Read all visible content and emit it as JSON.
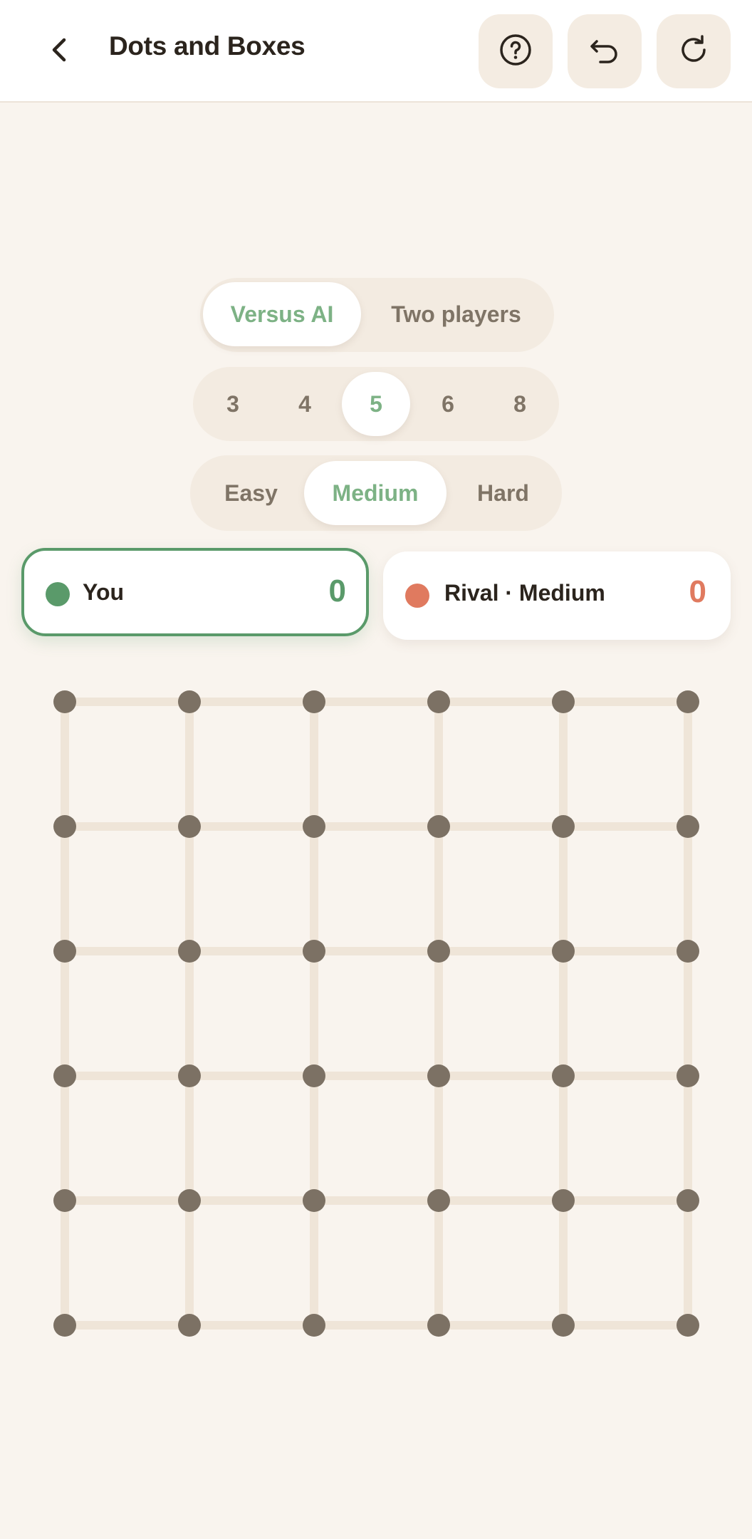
{
  "header": {
    "title": "Dots and Boxes"
  },
  "icons": {
    "back": "chevron-left-icon",
    "help": "help-circle-icon",
    "undo": "undo-icon",
    "restart": "refresh-icon"
  },
  "mode_options": [
    "Versus AI",
    "Two players"
  ],
  "mode_selected": "Versus AI",
  "size_options": [
    "3",
    "4",
    "5",
    "6",
    "8"
  ],
  "size_selected": "5",
  "difficulty_options": [
    "Easy",
    "Medium",
    "Hard"
  ],
  "difficulty_selected": "Medium",
  "players": [
    {
      "name": "You",
      "score": "0",
      "color": "#5a9a6a",
      "active": true
    },
    {
      "name": "Rival · Medium",
      "score": "0",
      "color": "#e07a5f",
      "active": false
    }
  ],
  "board": {
    "boxes_per_side": 5,
    "drawn_lines": 0,
    "dot_color": "#7c7164",
    "line_color": "#efe5d8"
  },
  "colors": {
    "background": "#f9f4ee",
    "accent": "#7db285",
    "you": "#5a9a6a",
    "rival": "#e07a5f"
  }
}
